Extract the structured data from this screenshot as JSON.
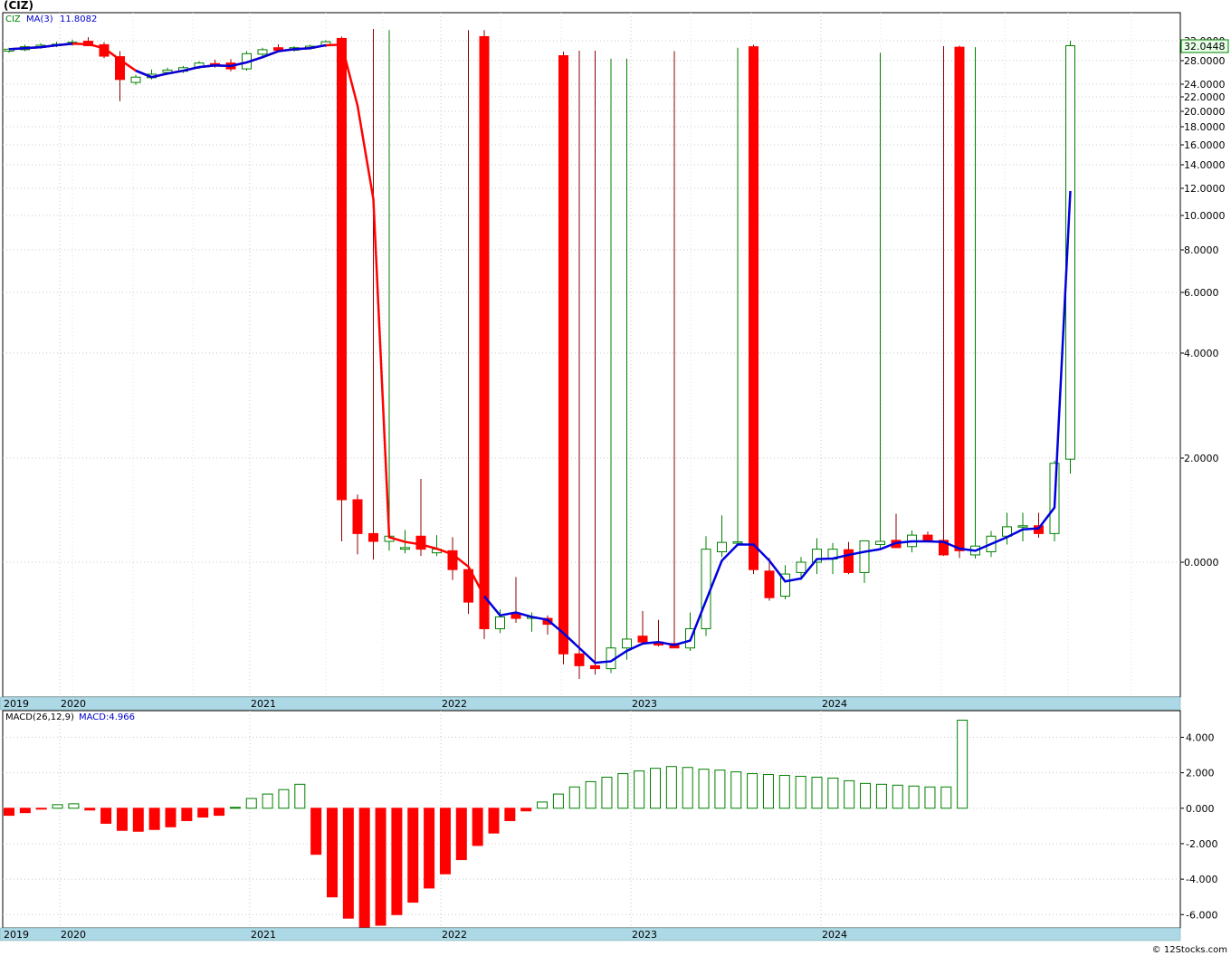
{
  "header": {
    "symbol_title": "(CIZ)"
  },
  "footer": {
    "credit": "© 12Stocks.com"
  },
  "colors": {
    "up": "#008000",
    "down": "#ff0000",
    "ma_down": "#ff0000",
    "ma_up": "#0000dd",
    "axis_band": "#add8e6",
    "grid": "#c8c8c8"
  },
  "chart_data": [
    {
      "type": "candlestick",
      "legend": {
        "symbol": "CIZ",
        "ma_label": "MA(3)",
        "ma_value": "11.8082"
      },
      "last_price_label": "32.0448",
      "y_ticks": [
        "0.0000",
        "2.0000",
        "4.0000",
        "6.0000",
        "8.0000",
        "10.0000",
        "12.0000",
        "14.0000",
        "16.0000",
        "18.0000",
        "20.0000",
        "22.0000",
        "24.0000",
        "28.0000",
        "32.0000"
      ],
      "x_labels": [
        "2019",
        "2020",
        "2021",
        "2022",
        "2023",
        "2024"
      ],
      "grid": true,
      "candles": [
        {
          "o": 29.9,
          "h": 30.6,
          "l": 29.6,
          "c": 30.3
        },
        {
          "o": 30.2,
          "h": 31.2,
          "l": 29.9,
          "c": 30.8
        },
        {
          "o": 30.7,
          "h": 31.5,
          "l": 30.4,
          "c": 31.1
        },
        {
          "o": 31.0,
          "h": 31.8,
          "l": 30.7,
          "c": 31.3
        },
        {
          "o": 31.3,
          "h": 32.2,
          "l": 31.0,
          "c": 31.7
        },
        {
          "o": 31.9,
          "h": 32.6,
          "l": 31.2,
          "c": 31.0
        },
        {
          "o": 31.2,
          "h": 31.7,
          "l": 28.5,
          "c": 28.9
        },
        {
          "o": 28.8,
          "h": 29.9,
          "l": 21.4,
          "c": 24.8
        },
        {
          "o": 24.3,
          "h": 25.6,
          "l": 23.9,
          "c": 25.2
        },
        {
          "o": 25.1,
          "h": 26.5,
          "l": 24.8,
          "c": 25.7
        },
        {
          "o": 26.0,
          "h": 26.8,
          "l": 25.6,
          "c": 26.4
        },
        {
          "o": 26.2,
          "h": 27.1,
          "l": 25.9,
          "c": 26.8
        },
        {
          "o": 26.9,
          "h": 27.9,
          "l": 26.6,
          "c": 27.6
        },
        {
          "o": 27.5,
          "h": 28.2,
          "l": 26.8,
          "c": 27.1
        },
        {
          "o": 27.6,
          "h": 28.3,
          "l": 26.2,
          "c": 26.6
        },
        {
          "o": 26.6,
          "h": 29.9,
          "l": 26.3,
          "c": 29.4
        },
        {
          "o": 29.3,
          "h": 30.6,
          "l": 28.9,
          "c": 30.2
        },
        {
          "o": 30.6,
          "h": 31.3,
          "l": 30.0,
          "c": 30.1
        },
        {
          "o": 30.1,
          "h": 30.9,
          "l": 29.8,
          "c": 30.6
        },
        {
          "o": 30.5,
          "h": 31.2,
          "l": 30.2,
          "c": 30.9
        },
        {
          "o": 31.1,
          "h": 32.1,
          "l": 30.7,
          "c": 31.8
        },
        {
          "o": 32.4,
          "h": 32.7,
          "l": 0.4,
          "c": 1.2
        },
        {
          "o": 1.2,
          "h": 1.3,
          "l": 0.15,
          "c": 0.55
        },
        {
          "o": 0.55,
          "h": 34.0,
          "l": 0.05,
          "c": 0.4
        },
        {
          "o": 0.4,
          "h": 33.8,
          "l": 0.22,
          "c": 0.5
        },
        {
          "o": 0.25,
          "h": 0.62,
          "l": 0.17,
          "c": 0.28
        },
        {
          "o": 0.5,
          "h": 1.6,
          "l": 0.12,
          "c": 0.25
        },
        {
          "o": 0.18,
          "h": 0.52,
          "l": 0.12,
          "c": 0.25
        },
        {
          "o": 0.22,
          "h": 0.48,
          "l": -0.12,
          "c": -0.05
        },
        {
          "o": -0.05,
          "h": 33.8,
          "l": -0.35,
          "c": -0.27
        },
        {
          "o": 32.7,
          "h": 33.8,
          "l": -0.52,
          "c": -0.45
        },
        {
          "o": -0.45,
          "h": -0.32,
          "l": -0.48,
          "c": -0.37
        },
        {
          "o": -0.35,
          "h": -0.1,
          "l": -0.41,
          "c": -0.38
        },
        {
          "o": -0.38,
          "h": -0.34,
          "l": -0.47,
          "c": -0.37
        },
        {
          "o": -0.38,
          "h": -0.36,
          "l": -0.49,
          "c": -0.42
        },
        {
          "o": 29.0,
          "h": 29.8,
          "l": -0.69,
          "c": -0.62
        },
        {
          "o": -0.62,
          "h": 30.0,
          "l": -0.79,
          "c": -0.7
        },
        {
          "o": -0.7,
          "h": 30.0,
          "l": -0.76,
          "c": -0.72
        },
        {
          "o": -0.72,
          "h": 28.4,
          "l": -0.75,
          "c": -0.58
        },
        {
          "o": -0.58,
          "h": 28.4,
          "l": -0.66,
          "c": -0.52
        },
        {
          "o": -0.5,
          "h": -0.33,
          "l": -0.56,
          "c": -0.54
        },
        {
          "o": -0.54,
          "h": -0.39,
          "l": -0.57,
          "c": -0.56
        },
        {
          "o": -0.55,
          "h": 29.9,
          "l": -0.58,
          "c": -0.58
        },
        {
          "o": -0.58,
          "h": -0.34,
          "l": -0.6,
          "c": -0.45
        },
        {
          "o": -0.45,
          "h": 0.5,
          "l": -0.5,
          "c": 0.25
        },
        {
          "o": 0.2,
          "h": 0.9,
          "l": 0.1,
          "c": 0.38
        },
        {
          "o": 0.38,
          "h": 30.6,
          "l": 0.32,
          "c": 0.39
        },
        {
          "o": 30.8,
          "h": 31.2,
          "l": -0.08,
          "c": -0.05
        },
        {
          "o": -0.06,
          "h": 0.08,
          "l": -0.26,
          "c": -0.24
        },
        {
          "o": -0.23,
          "h": -0.02,
          "l": -0.25,
          "c": -0.08
        },
        {
          "o": -0.07,
          "h": 0.1,
          "l": -0.12,
          "c": 0.0
        },
        {
          "o": 0.0,
          "h": 0.46,
          "l": -0.08,
          "c": 0.25
        },
        {
          "o": 0.06,
          "h": 0.37,
          "l": -0.08,
          "c": 0.25
        },
        {
          "o": 0.24,
          "h": 0.39,
          "l": -0.08,
          "c": -0.07
        },
        {
          "o": -0.07,
          "h": 0.41,
          "l": -0.14,
          "c": 0.41
        },
        {
          "o": 0.34,
          "h": 29.6,
          "l": 0.26,
          "c": 0.4
        },
        {
          "o": 0.42,
          "h": 0.93,
          "l": 0.29,
          "c": 0.28
        },
        {
          "o": 0.3,
          "h": 0.61,
          "l": 0.19,
          "c": 0.52
        },
        {
          "o": 0.52,
          "h": 0.59,
          "l": 0.38,
          "c": 0.42
        },
        {
          "o": 0.42,
          "h": 30.9,
          "l": 0.12,
          "c": 0.14
        },
        {
          "o": 30.7,
          "h": 31.0,
          "l": 0.08,
          "c": 0.22
        },
        {
          "o": 0.14,
          "h": 30.7,
          "l": 0.07,
          "c": 0.31
        },
        {
          "o": 0.2,
          "h": 0.6,
          "l": 0.1,
          "c": 0.5
        },
        {
          "o": 0.5,
          "h": 0.95,
          "l": 0.34,
          "c": 0.68
        },
        {
          "o": 0.68,
          "h": 0.95,
          "l": 0.4,
          "c": 0.7
        },
        {
          "o": 0.7,
          "h": 0.95,
          "l": 0.47,
          "c": 0.55
        },
        {
          "o": 0.55,
          "h": 1.95,
          "l": 0.4,
          "c": 1.9
        },
        {
          "o": 1.98,
          "h": 32.0,
          "l": 1.7,
          "c": 31.0
        }
      ],
      "ma3": [
        30.3,
        30.5,
        30.7,
        31.1,
        31.4,
        31.3,
        30.5,
        28.2,
        26.3,
        25.2,
        25.8,
        26.3,
        26.9,
        27.2,
        27.1,
        27.7,
        28.7,
        29.9,
        30.3,
        30.5,
        31.1,
        31.2,
        20.8,
        11.2,
        0.48,
        0.39,
        0.34,
        0.26,
        0.15,
        -0.03,
        -0.23,
        -0.36,
        -0.34,
        -0.37,
        -0.39,
        -0.48,
        -0.58,
        -0.68,
        -0.67,
        -0.6,
        -0.55,
        -0.54,
        -0.56,
        -0.53,
        -0.26,
        0.03,
        0.34,
        0.34,
        0.03,
        -0.13,
        -0.11,
        0.06,
        0.07,
        0.14,
        0.2,
        0.25,
        0.37,
        0.4,
        0.4,
        0.39,
        0.26,
        0.22,
        0.35,
        0.48,
        0.63,
        0.65,
        1.05,
        11.8
      ],
      "ma_color_break": 30
    },
    {
      "type": "bar",
      "legend": {
        "label": "MACD(26,12,9)",
        "value_label": "MACD:4.966"
      },
      "y_ticks": [
        "-6.000",
        "-4.000",
        "-2.000",
        "0.000",
        "2.000",
        "4.000"
      ],
      "ylim": [
        -6.7,
        5.4
      ],
      "x_labels": [
        "2019",
        "2020",
        "2021",
        "2022",
        "2023",
        "2024"
      ],
      "values": [
        -0.4,
        -0.25,
        -0.05,
        0.2,
        0.25,
        -0.1,
        -0.85,
        -1.25,
        -1.3,
        -1.2,
        -1.05,
        -0.7,
        -0.5,
        -0.4,
        0.05,
        0.55,
        0.8,
        1.05,
        1.35,
        -2.6,
        -5.0,
        -6.2,
        -6.7,
        -6.6,
        -6.0,
        -5.3,
        -4.5,
        -3.7,
        -2.9,
        -2.1,
        -1.4,
        -0.7,
        -0.15,
        0.35,
        0.8,
        1.2,
        1.5,
        1.75,
        1.95,
        2.1,
        2.25,
        2.35,
        2.3,
        2.2,
        2.15,
        2.05,
        1.95,
        1.9,
        1.85,
        1.8,
        1.75,
        1.7,
        1.55,
        1.4,
        1.35,
        1.3,
        1.25,
        1.2,
        1.2,
        4.966
      ]
    }
  ]
}
